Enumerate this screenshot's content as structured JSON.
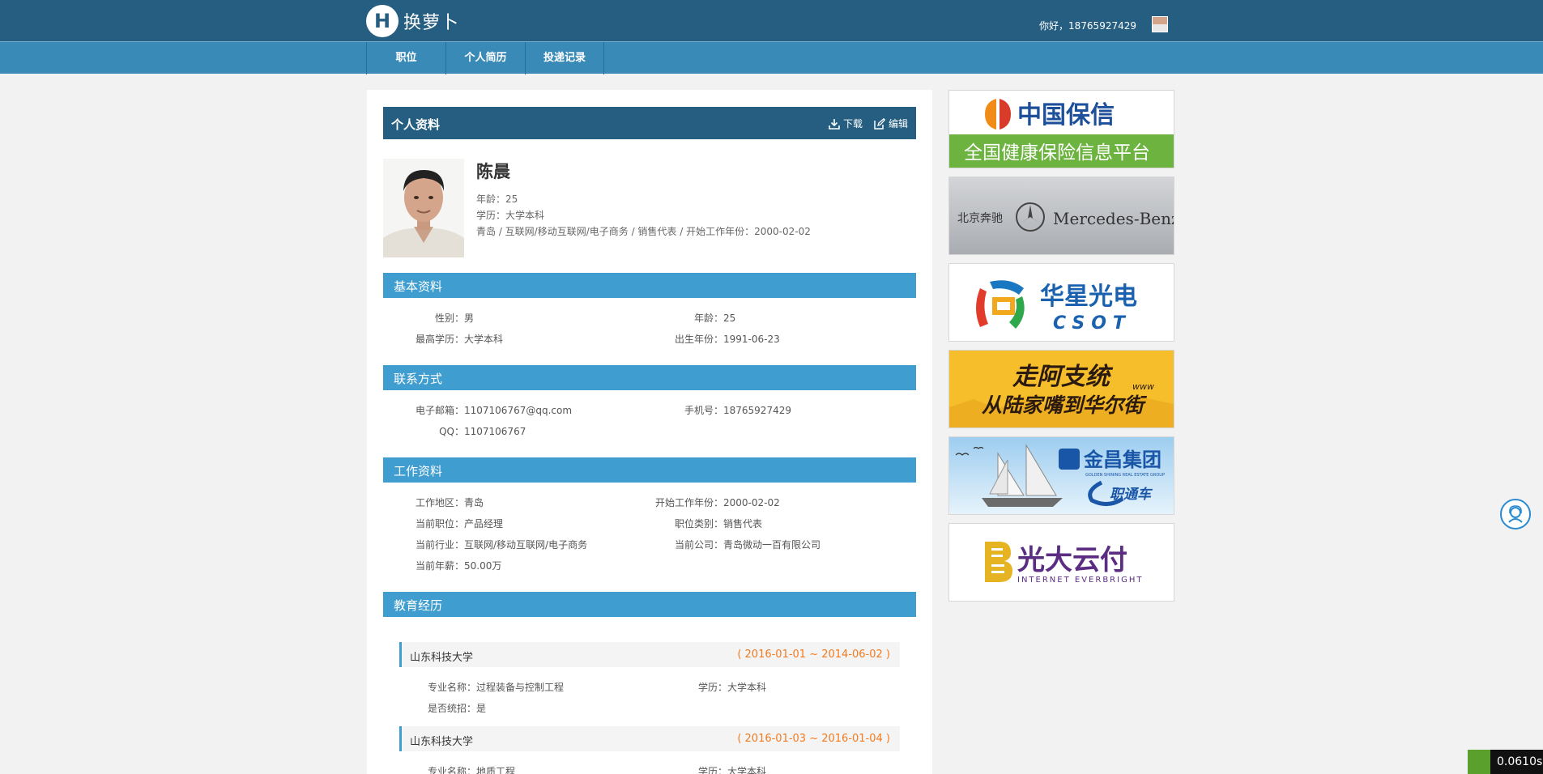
{
  "header": {
    "brand": "换萝卜",
    "logo_letter": "H",
    "greeting": "你好，18765927429"
  },
  "nav": {
    "items": [
      {
        "label": "职位"
      },
      {
        "label": "个人简历"
      },
      {
        "label": "投递记录"
      }
    ]
  },
  "profile": {
    "title": "个人资料",
    "download_label": "下载",
    "edit_label": "编辑",
    "name": "陈晨",
    "age_line": "年龄：25",
    "edu_line": "学历：大学本科",
    "summary_line": "青岛 / 互联网/移动互联网/电子商务 / 销售代表 / 开始工作年份：2000-02-02"
  },
  "basic": {
    "title": "基本资料",
    "gender_label": "性别：",
    "gender": "男",
    "age_label": "年龄：",
    "age": "25",
    "edu_label": "最高学历：",
    "edu": "大学本科",
    "birth_label": "出生年份：",
    "birth": "1991-06-23"
  },
  "contact": {
    "title": "联系方式",
    "email_label": "电子邮箱：",
    "email": "1107106767@qq.com",
    "phone_label": "手机号：",
    "phone": "18765927429",
    "qq_label": "QQ：",
    "qq": "1107106767"
  },
  "work": {
    "title": "工作资料",
    "area_label": "工作地区：",
    "area": "青岛",
    "start_label": "开始工作年份：",
    "start": "2000-02-02",
    "position_label": "当前职位：",
    "position": "产品经理",
    "category_label": "职位类别：",
    "category": "销售代表",
    "industry_label": "当前行业：",
    "industry": "互联网/移动互联网/电子商务",
    "company_label": "当前公司：",
    "company": "青岛微动一百有限公司",
    "salary_label": "当前年薪：",
    "salary": "50.00万"
  },
  "education": {
    "title": "教育经历",
    "items": [
      {
        "school": "山东科技大学",
        "dates": "( 2016-01-01 ~ 2014-06-02 )",
        "major_label": "专业名称：",
        "major": "过程装备与控制工程",
        "degree_label": "学历：",
        "degree": "大学本科",
        "unified_label": "是否统招：",
        "unified": "是"
      },
      {
        "school": "山东科技大学",
        "dates": "( 2016-01-03 ~ 2016-01-04 )",
        "major_label": "专业名称：",
        "major": "地质工程",
        "degree_label": "学历：",
        "degree": "大学本科"
      }
    ]
  },
  "ads": [
    {
      "main": "中国保信",
      "sub": "全国健康保险信息平台"
    },
    {
      "left": "北京奔驰",
      "right": "Mercedes-Benz"
    },
    {
      "main": "华星光电",
      "sub": "CSOT"
    },
    {
      "main": "走阿支统",
      "sub": "从陆家嘴到华尔街",
      "www": "www"
    },
    {
      "main": "金昌集团",
      "sub": "GOLDEN SHINING REAL ESTATE GROUP",
      "tag": "职通车"
    },
    {
      "main": "光大云付",
      "sub": "INTERNET EVERBRIGHT"
    }
  ],
  "timer": "0.0610s",
  "colors": {
    "header_dark": "#255e80",
    "nav_blue": "#3a8ab8",
    "section_blue": "#3f9dcf",
    "date_orange": "#f27a20"
  }
}
